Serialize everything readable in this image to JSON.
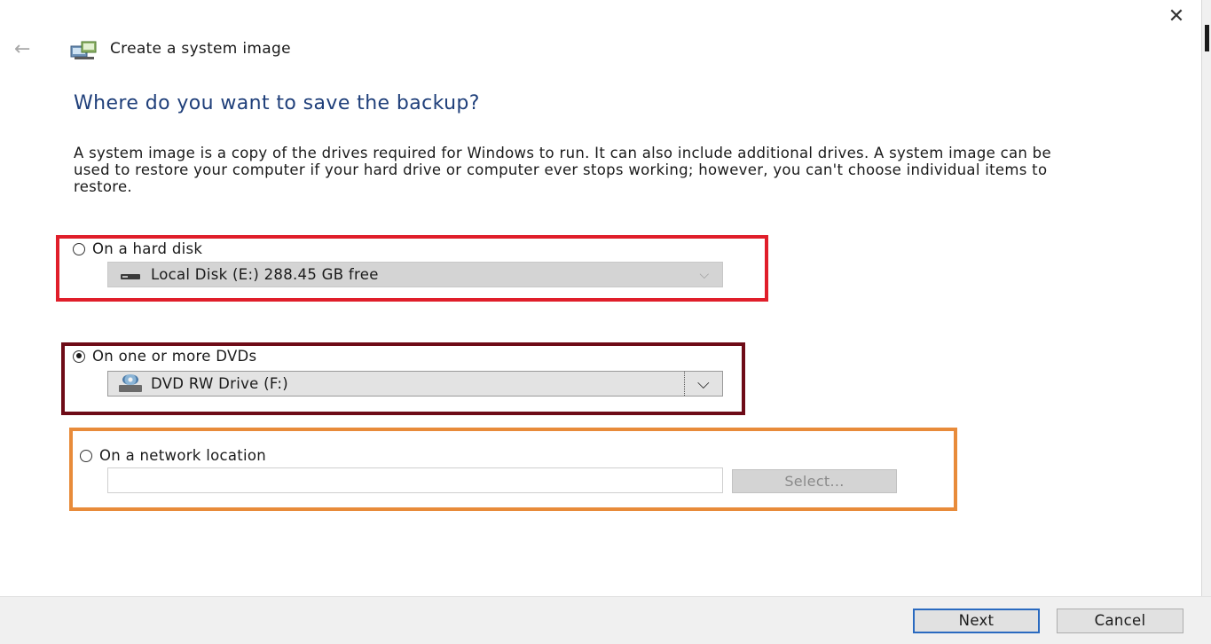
{
  "window": {
    "title": "Create a system image",
    "close_label": "✕",
    "back_label": "←"
  },
  "main": {
    "heading": "Where do you want to save the backup?",
    "description": "A system image is a copy of the drives required for Windows to run. It can also include additional drives. A system image can be used to restore your computer if your hard drive or computer ever stops working; however, you can't choose individual items to restore."
  },
  "options": {
    "hard_disk": {
      "label": "On a hard disk",
      "selected": false,
      "drive_value": "Local Disk (E:)  288.45 GB free",
      "drive_icon": "hard-drive-icon"
    },
    "dvd": {
      "label": "On one or more DVDs",
      "selected": true,
      "drive_value": "DVD RW Drive (F:)",
      "drive_icon": "dvd-drive-icon"
    },
    "network": {
      "label": "On a network location",
      "selected": false,
      "input_value": "",
      "select_label": "Select..."
    }
  },
  "highlights": {
    "hard_disk_color": "#e01e2a",
    "dvd_color": "#6e0b17",
    "network_color": "#e88b3a"
  },
  "footer": {
    "next_label": "Next",
    "cancel_label": "Cancel"
  }
}
